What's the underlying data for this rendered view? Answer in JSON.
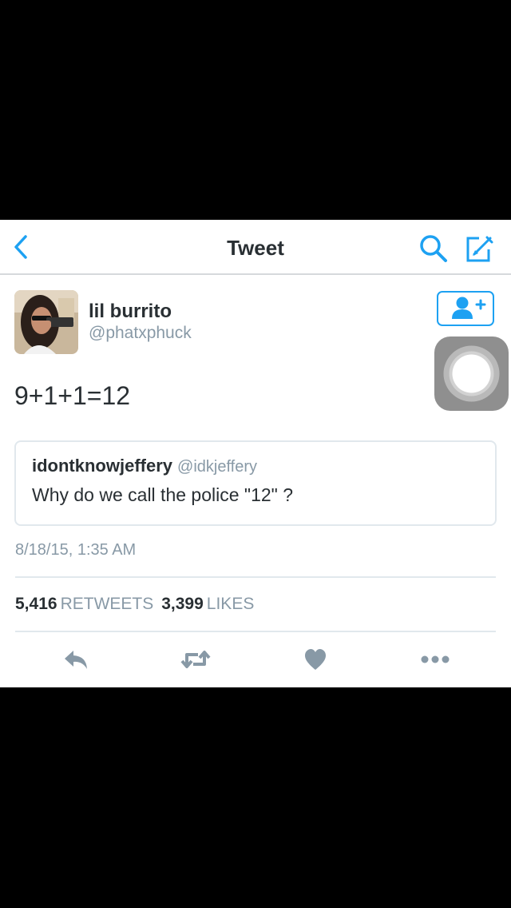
{
  "nav": {
    "title": "Tweet",
    "back_icon": "chevron-left-icon",
    "search_icon": "search-icon",
    "compose_icon": "compose-icon",
    "accent": "#1da1f2"
  },
  "tweet": {
    "author_name": "lil burrito",
    "author_handle": "@phatxphuck",
    "text": "9+1+1=12",
    "timestamp": "8/18/15, 1:35 AM",
    "retweets_count": "5,416",
    "retweets_label": "RETWEETS",
    "likes_count": "3,399",
    "likes_label": "LIKES"
  },
  "quote": {
    "author_name": "idontknowjeffery",
    "author_handle": "@idkjeffery",
    "text": "Why do we call the police \"12\" ?"
  },
  "actions": [
    "reply-icon",
    "retweet-icon",
    "like-icon",
    "more-icon"
  ]
}
